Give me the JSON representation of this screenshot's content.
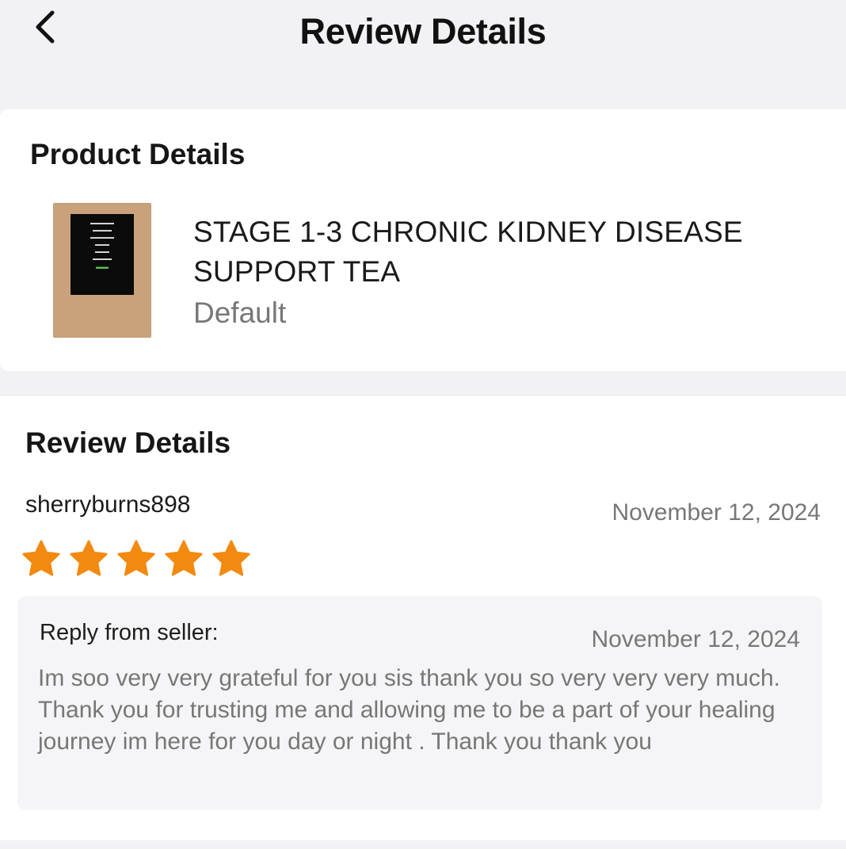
{
  "header": {
    "title": "Review Details"
  },
  "product": {
    "section_title": "Product Details",
    "name": "STAGE 1-3 CHRONIC KIDNEY DISEASE SUPPORT TEA",
    "variant": "Default",
    "thumbnail_icon": "product-image"
  },
  "review": {
    "section_title": "Review Details",
    "username": "sherryburns898",
    "date": "November 12, 2024",
    "rating": 5,
    "rating_max": 5,
    "star_color": "#f28a0f",
    "reply": {
      "label": "Reply from seller:",
      "date": "November 12, 2024",
      "text": "Im soo very very grateful for you sis thank you so very very very much. Thank you for trusting me and allowing me to be a part of your healing journey im here for you day or night . Thank you thank you"
    }
  }
}
